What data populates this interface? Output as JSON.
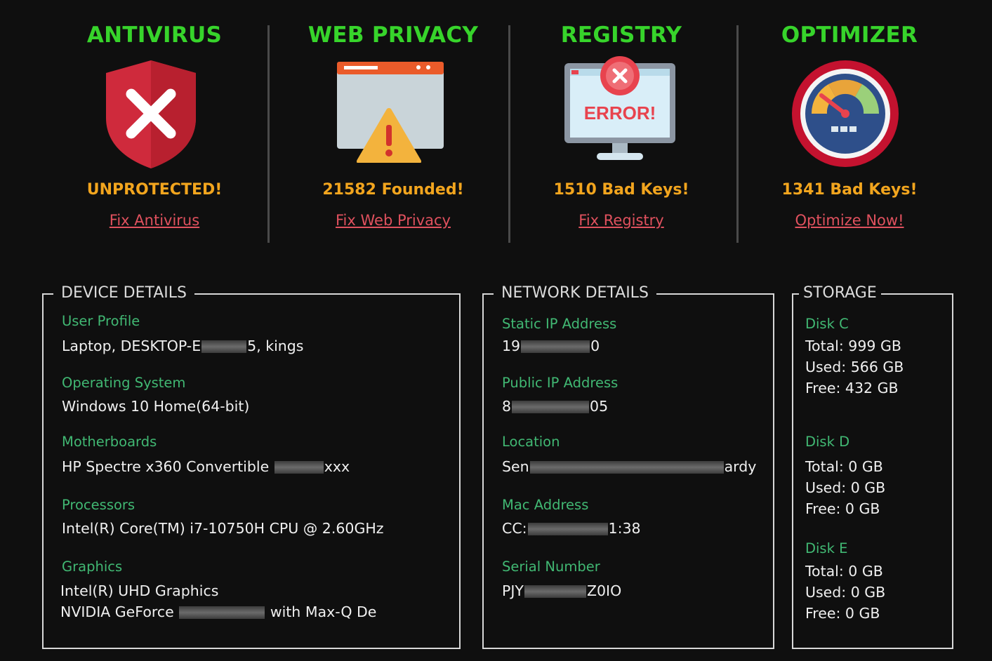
{
  "cards": [
    {
      "title": "ANTIVIRUS",
      "status": "UNPROTECTED!",
      "action": "Fix Antivirus",
      "icon": "shield-x-icon"
    },
    {
      "title": "WEB PRIVACY",
      "status": "21582 Founded!",
      "action": "Fix Web Privacy",
      "icon": "browser-warning-icon"
    },
    {
      "title": "REGISTRY",
      "status": "1510 Bad Keys!",
      "action": "Fix Registry",
      "icon": "monitor-error-icon"
    },
    {
      "title": "OPTIMIZER",
      "status": "1341 Bad Keys!",
      "action": "Optimize Now!",
      "icon": "speedometer-icon"
    }
  ],
  "registry_icon_text": "ERROR!",
  "device": {
    "title": "DEVICE DETAILS",
    "user_profile_label": "User Profile",
    "user_profile_a": "Laptop, DESKTOP-E",
    "user_profile_b": "5, kings",
    "os_label": "Operating System",
    "os": "Windows 10 Home(64-bit)",
    "mb_label": "Motherboards",
    "mb_a": "HP Spectre x360 Convertible",
    "mb_b": "xxx",
    "cpu_label": "Processors",
    "cpu": "Intel(R) Core(TM) i7-10750H CPU @ 2.60GHz",
    "gpu_label": "Graphics",
    "gpu1": "Intel(R) UHD Graphics",
    "gpu2_a": "NVIDIA GeForce",
    "gpu2_b": "with Max-Q De"
  },
  "network": {
    "title": "NETWORK DETAILS",
    "static_label": "Static IP Address",
    "static_a": "19",
    "static_b": "0",
    "public_label": "Public IP Address",
    "public_a": "8",
    "public_b": "05",
    "loc_label": "Location",
    "loc_a": "Sen",
    "loc_b": "ardy",
    "mac_label": "Mac Address",
    "mac_a": "CC:",
    "mac_b": "1:38",
    "serial_label": "Serial Number",
    "serial_a": "PJY",
    "serial_b": "Z0IO"
  },
  "storage": {
    "title": "STORAGE",
    "disks": [
      {
        "name": "Disk C",
        "total": "Total: 999 GB",
        "used": "Used: 566 GB",
        "free": "Free: 432 GB"
      },
      {
        "name": "Disk D",
        "total": "Total: 0 GB",
        "used": "Used: 0 GB",
        "free": "Free: 0 GB"
      },
      {
        "name": "Disk E",
        "total": "Total: 0 GB",
        "used": "Used: 0 GB",
        "free": "Free: 0 GB"
      }
    ]
  },
  "colors": {
    "title_green": "#37d42b",
    "status_orange": "#f2a51e",
    "link_red": "#e0515e",
    "label_green": "#41b873"
  }
}
